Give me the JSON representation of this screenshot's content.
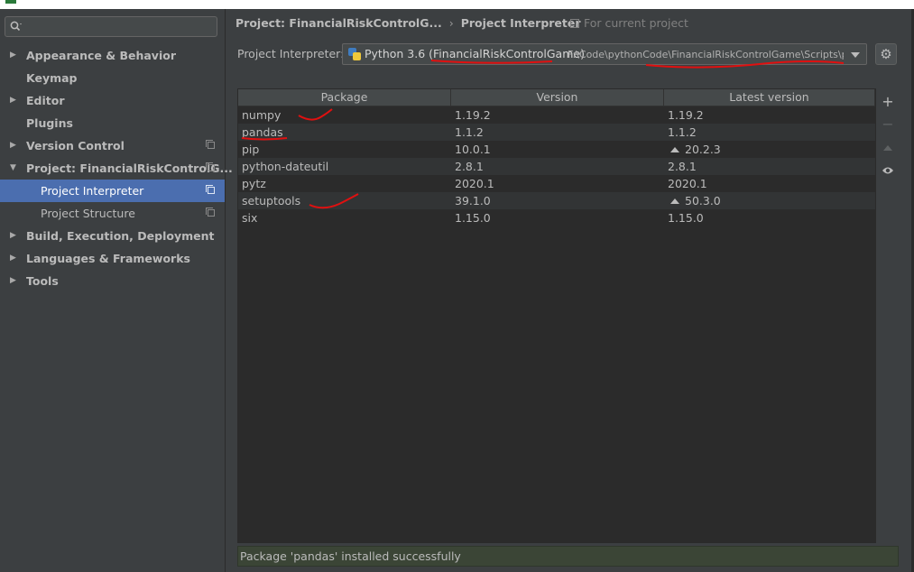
{
  "search": {
    "placeholder": "",
    "value": ""
  },
  "sidebar": {
    "items": [
      {
        "label": "Appearance & Behavior",
        "arrow": "▶",
        "copy": false,
        "selected": false,
        "child": false
      },
      {
        "label": "Keymap",
        "arrow": "",
        "copy": false,
        "selected": false,
        "child": false
      },
      {
        "label": "Editor",
        "arrow": "▶",
        "copy": false,
        "selected": false,
        "child": false
      },
      {
        "label": "Plugins",
        "arrow": "",
        "copy": false,
        "selected": false,
        "child": false
      },
      {
        "label": "Version Control",
        "arrow": "▶",
        "copy": true,
        "selected": false,
        "child": false
      },
      {
        "label": "Project: FinancialRiskControlG...",
        "arrow": "▼",
        "copy": true,
        "selected": false,
        "child": false
      },
      {
        "label": "Project Interpreter",
        "arrow": "",
        "copy": true,
        "selected": true,
        "child": true
      },
      {
        "label": "Project Structure",
        "arrow": "",
        "copy": true,
        "selected": false,
        "child": true
      },
      {
        "label": "Build, Execution, Deployment",
        "arrow": "▶",
        "copy": false,
        "selected": false,
        "child": false
      },
      {
        "label": "Languages & Frameworks",
        "arrow": "▶",
        "copy": false,
        "selected": false,
        "child": false
      },
      {
        "label": "Tools",
        "arrow": "▶",
        "copy": false,
        "selected": false,
        "child": false
      }
    ]
  },
  "breadcrumb": {
    "project": "Project: FinancialRiskControlG...",
    "separator": "›",
    "page": "Project Interpreter"
  },
  "for_current_project": "For current project",
  "interpreter": {
    "label": "Project Interpreter:",
    "name": "Python 3.6 (FinancialRiskControlGame)",
    "path": "F:\\Code\\pythonCode\\FinancialRiskControlGame\\Scripts\\py"
  },
  "table": {
    "headers": [
      "Package",
      "Version",
      "Latest version"
    ],
    "rows": [
      {
        "package": "numpy",
        "version": "1.19.2",
        "latest": "1.19.2",
        "upgrade": false
      },
      {
        "package": "pandas",
        "version": "1.1.2",
        "latest": "1.1.2",
        "upgrade": false
      },
      {
        "package": "pip",
        "version": "10.0.1",
        "latest": "20.2.3",
        "upgrade": true
      },
      {
        "package": "python-dateutil",
        "version": "2.8.1",
        "latest": "2.8.1",
        "upgrade": false
      },
      {
        "package": "pytz",
        "version": "2020.1",
        "latest": "2020.1",
        "upgrade": false
      },
      {
        "package": "setuptools",
        "version": "39.1.0",
        "latest": "50.3.0",
        "upgrade": true
      },
      {
        "package": "six",
        "version": "1.15.0",
        "latest": "1.15.0",
        "upgrade": false
      }
    ]
  },
  "status": "Package 'pandas' installed successfully",
  "colors": {
    "background": "#3c3f41",
    "selection": "#4b6eaf",
    "table_bg": "#2b2b2b",
    "status_bg": "#3b4536",
    "annotation": "#e01010"
  },
  "icons": {
    "search": "search-icon",
    "gear": "gear-icon",
    "add": "add-icon",
    "remove": "remove-icon",
    "upgrade": "upgrade-icon",
    "eye": "eye-icon",
    "python": "python-icon",
    "copy": "copy-icon"
  }
}
